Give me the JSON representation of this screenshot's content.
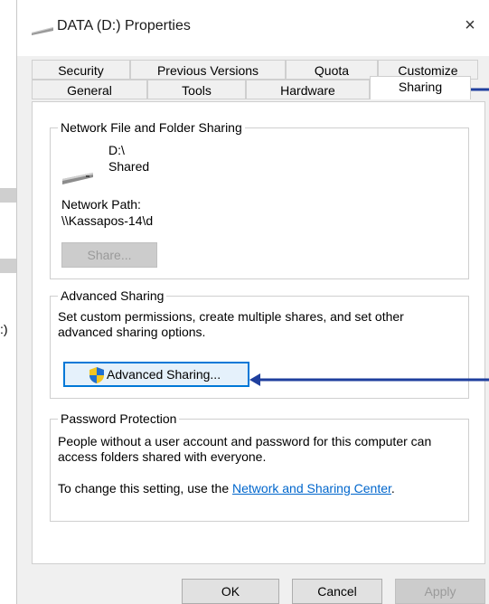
{
  "window": {
    "title": "DATA (D:) Properties",
    "close_glyph": "×"
  },
  "background": {
    "stray_text": ":)"
  },
  "tabs": {
    "row1": [
      "Security",
      "Previous Versions",
      "Quota",
      "Customize"
    ],
    "row2": [
      "General",
      "Tools",
      "Hardware",
      "Sharing"
    ],
    "selected": "Sharing"
  },
  "network_sharing": {
    "label": "Network File and Folder Sharing",
    "drive_name": "D:\\",
    "drive_status": "Shared",
    "network_path_label": "Network Path:",
    "network_path_value": "\\\\Kassapos-14\\d",
    "share_button": "Share..."
  },
  "advanced_sharing": {
    "label": "Advanced Sharing",
    "description": "Set custom permissions, create multiple shares, and set other advanced sharing options.",
    "button": "Advanced Sharing..."
  },
  "password_protection": {
    "label": "Password Protection",
    "description": "People without a user account and password for this computer can access folders shared with everyone.",
    "change_prefix": "To change this setting, use the ",
    "link": "Network and Sharing Center",
    "change_suffix": "."
  },
  "footer": {
    "ok": "OK",
    "cancel": "Cancel",
    "apply": "Apply"
  },
  "colors": {
    "annotation_arrow": "#1f3f9e",
    "link": "#0066cc",
    "focus_border": "#0078d7"
  }
}
